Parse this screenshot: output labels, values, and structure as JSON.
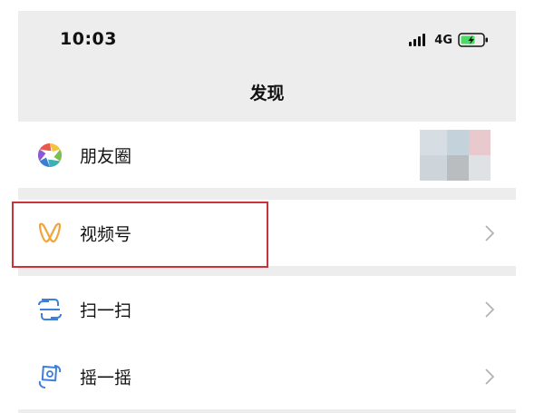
{
  "status_bar": {
    "time": "10:03",
    "network": "4G",
    "icons": [
      "signal-icon",
      "battery-charging-icon"
    ]
  },
  "nav": {
    "title": "发现"
  },
  "menu": {
    "items": [
      {
        "label": "朋友圈",
        "icon": "moments-icon"
      },
      {
        "label": "视频号",
        "icon": "channels-icon"
      },
      {
        "label": "扫一扫",
        "icon": "scan-icon"
      },
      {
        "label": "摇一摇",
        "icon": "shake-icon"
      }
    ]
  },
  "colors": {
    "background": "#ededed",
    "row_bg": "#ffffff",
    "channels_accent": "#f0a53a",
    "scan_accent": "#3d7fd9",
    "highlight": "#c9343b"
  }
}
